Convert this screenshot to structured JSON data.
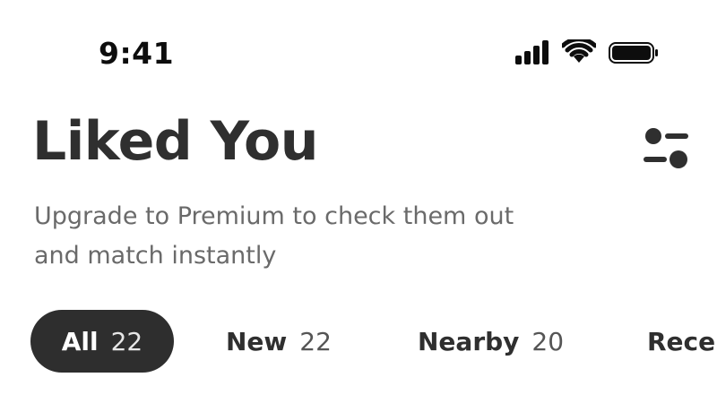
{
  "status_bar": {
    "time": "9:41",
    "icons": [
      "signal-icon",
      "wifi-icon",
      "battery-icon"
    ]
  },
  "header": {
    "title": "Liked You",
    "subtitle_line1": "Upgrade to Premium to check them out",
    "subtitle_line2": "and match instantly",
    "filter_icon": "filter-sliders-icon"
  },
  "tabs": [
    {
      "label": "All",
      "count": "22",
      "active": true
    },
    {
      "label": "New",
      "count": "22",
      "active": false
    },
    {
      "label": "Nearby",
      "count": "20",
      "active": false
    },
    {
      "label": "Recen",
      "count": "",
      "active": false
    }
  ],
  "colors": {
    "text_primary": "#2f2f2f",
    "text_secondary": "#6a6a6a",
    "active_tab_bg": "#2e2e2e",
    "active_tab_text": "#ffffff"
  }
}
